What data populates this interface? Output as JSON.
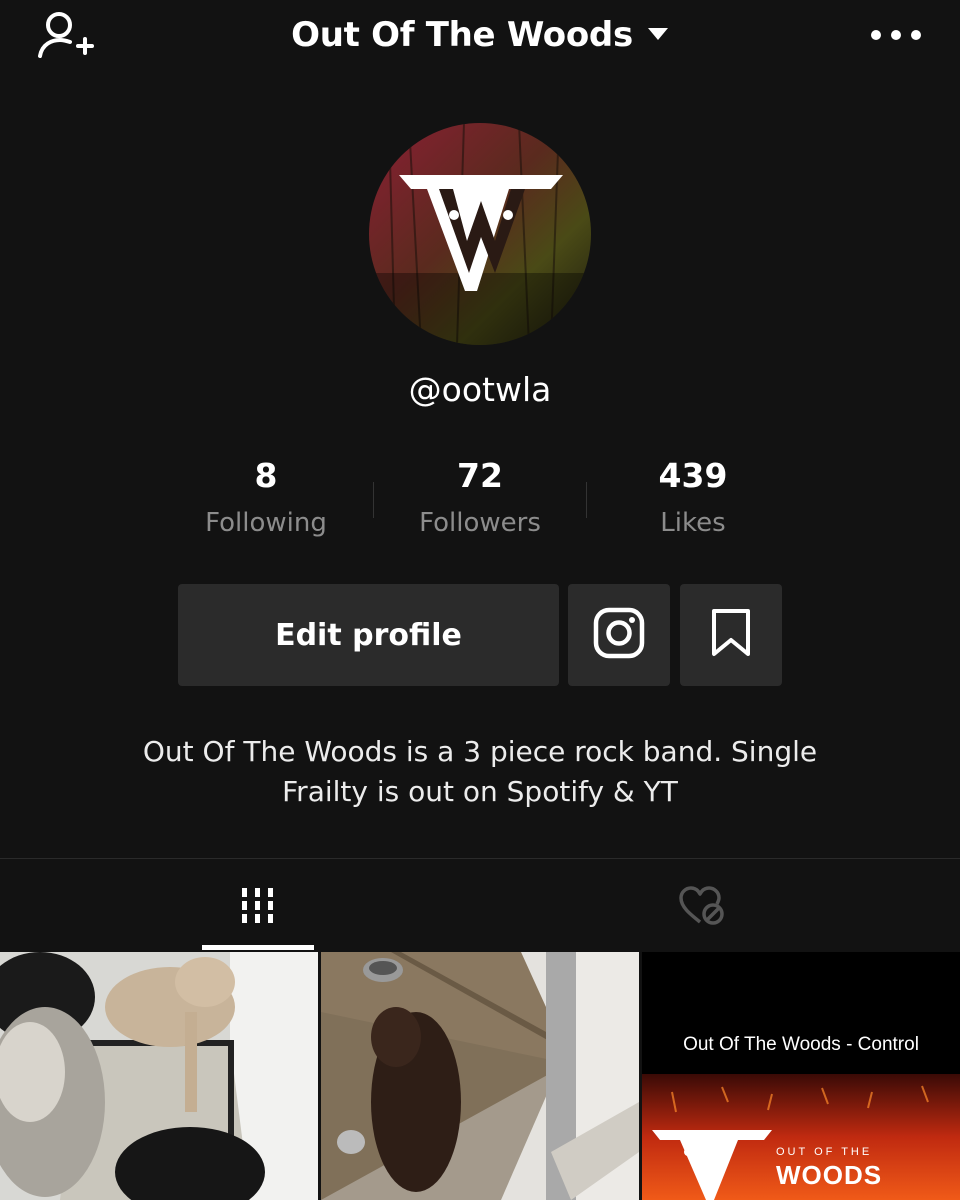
{
  "header": {
    "title": "Out Of The Woods",
    "icons": [
      "add-user-icon",
      "dropdown-caret-icon",
      "more-icon"
    ]
  },
  "profile": {
    "handle": "@ootwla",
    "bio_line1": "Out Of The Woods is a 3 piece rock band. Single",
    "bio_line2": "Frailty is out on Spotify & YT"
  },
  "stats": [
    {
      "value": "8",
      "label": "Following"
    },
    {
      "value": "72",
      "label": "Followers"
    },
    {
      "value": "439",
      "label": "Likes"
    }
  ],
  "actions": {
    "edit_profile_label": "Edit profile",
    "icons": [
      "instagram-icon",
      "bookmark-icon"
    ]
  },
  "tabs": {
    "icons": [
      "grid-icon",
      "liked-hidden-icon"
    ],
    "active": "videos"
  },
  "videos": [
    {
      "caption": ""
    },
    {
      "caption": ""
    },
    {
      "caption": "Out Of The Woods - Control",
      "logo_text_top": "OUT OF THE",
      "logo_text_bottom": "WOODS"
    }
  ],
  "colors": {
    "background": "#121212",
    "button": "#2b2b2b",
    "muted_text": "#8c8c8c"
  }
}
